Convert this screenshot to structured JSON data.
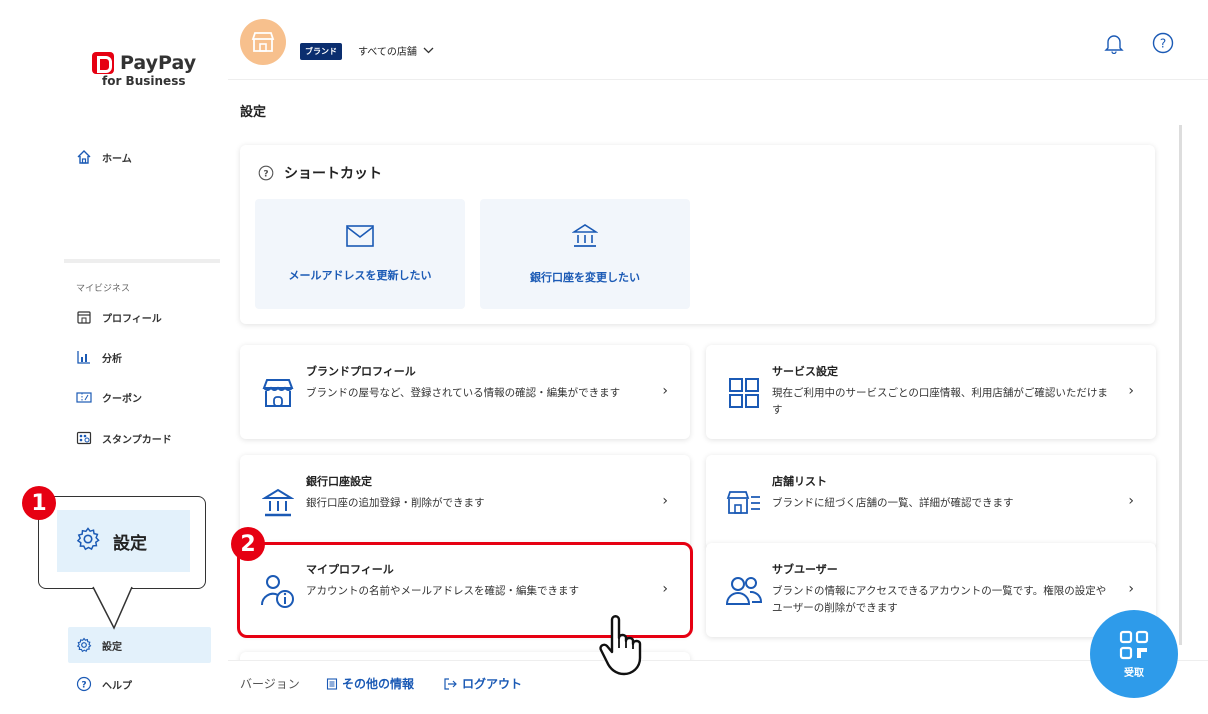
{
  "logo": {
    "name": "PayPay",
    "sub": "for Business"
  },
  "sidebar": {
    "home": "ホーム",
    "section_label": "マイビジネス",
    "items": [
      {
        "label": "プロフィール"
      },
      {
        "label": "分析"
      },
      {
        "label": "クーポン"
      },
      {
        "label": "スタンプカード"
      }
    ],
    "settings": "設定",
    "help": "ヘルプ"
  },
  "callout": {
    "label": "設定",
    "step1": "1",
    "step2": "2"
  },
  "header": {
    "brand_tag": "ブランド",
    "store_select": "すべての店舗"
  },
  "page_title": "設定",
  "shortcuts": {
    "title": "ショートカット",
    "items": [
      {
        "label": "メールアドレスを更新したい",
        "icon": "mail-icon"
      },
      {
        "label": "銀行口座を変更したい",
        "icon": "bank-icon"
      }
    ]
  },
  "cards": {
    "brand": {
      "title": "ブランドプロフィール",
      "desc": "ブランドの屋号など、登録されている情報の確認・編集ができます"
    },
    "service": {
      "title": "サービス設定",
      "desc": "現在ご利用中のサービスごとの口座情報、利用店舗がご確認いただけます"
    },
    "bank": {
      "title": "銀行口座設定",
      "desc": "銀行口座の追加登録・削除ができます"
    },
    "stores": {
      "title": "店舗リスト",
      "desc": "ブランドに紐づく店舗の一覧、詳細が確認できます"
    },
    "myprofile": {
      "title": "マイプロフィール",
      "desc": "アカウントの名前やメールアドレスを確認・編集できます"
    },
    "subuser": {
      "title": "サブユーザー",
      "desc": "ブランドの情報にアクセスできるアカウントの一覧です。権限の設定やユーザーの削除ができます"
    }
  },
  "footer": {
    "version": "バージョン",
    "info": "その他の情報",
    "logout": "ログアウト"
  },
  "fab": {
    "label": "受取"
  },
  "colors": {
    "accent": "#1b5ab5",
    "brand_red": "#e60012",
    "fab_blue": "#2e9bea",
    "tag_navy": "#0b2e6f"
  }
}
